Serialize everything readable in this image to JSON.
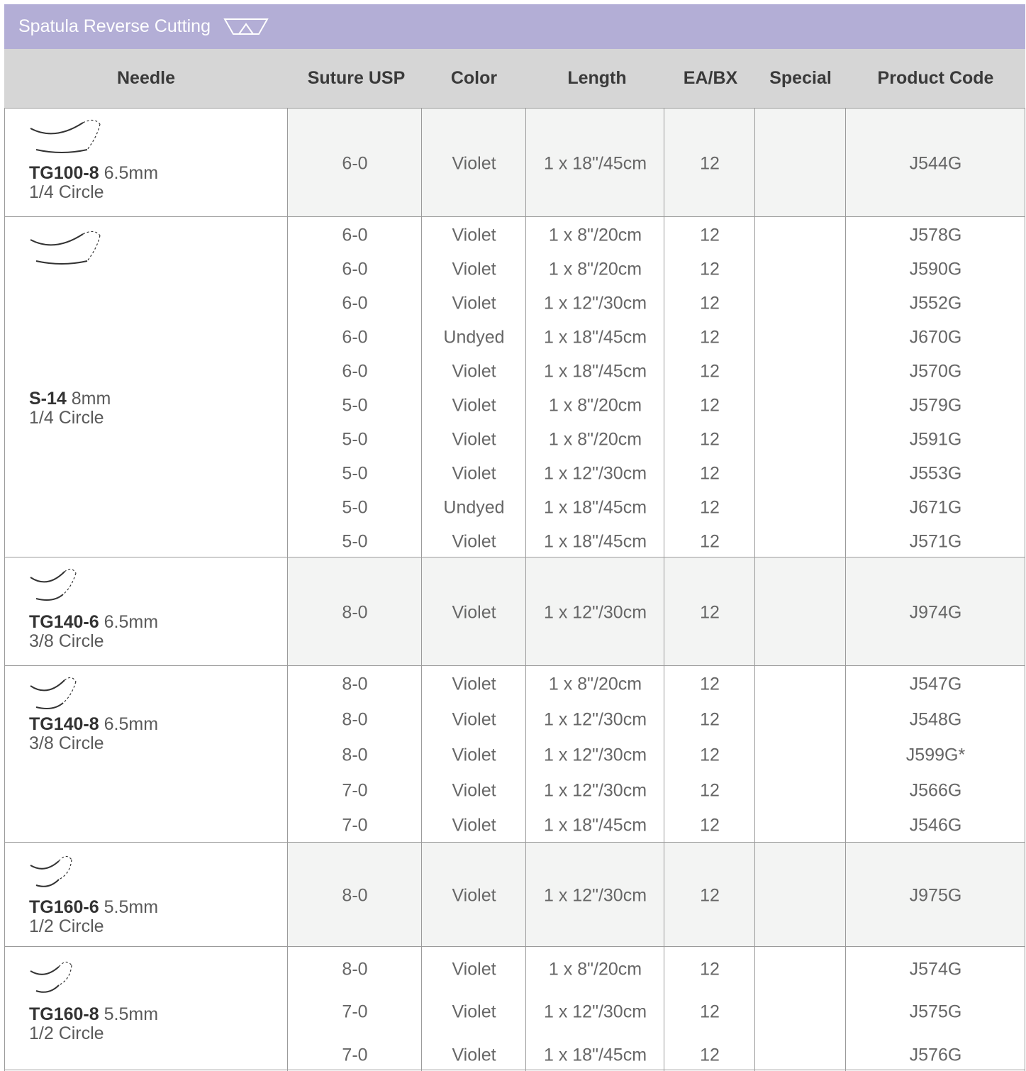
{
  "section": {
    "title": "Spatula Reverse Cutting",
    "icon": "spatula-reverse-cutting-cross-section-icon"
  },
  "columns": [
    "Needle",
    "Suture USP",
    "Color",
    "Length",
    "EA/BX",
    "Special",
    "Product Code"
  ],
  "groups": [
    {
      "needle": "TG100-8",
      "size": "6.5mm",
      "curvature": "1/4 Circle",
      "icon": "quarter-circle-needle-icon",
      "shaded": true,
      "rows": [
        {
          "usp": "6-0",
          "color": "Violet",
          "length": "1 x 18\"/45cm",
          "eabx": "12",
          "special": "",
          "code": "J544G"
        }
      ]
    },
    {
      "needle": "S-14",
      "size": "8mm",
      "curvature": "1/4 Circle",
      "icon": "quarter-circle-needle-icon",
      "shaded": false,
      "rows": [
        {
          "usp": "6-0",
          "color": "Violet",
          "length": "1 x 8\"/20cm",
          "eabx": "12",
          "special": "",
          "code": "J578G"
        },
        {
          "usp": "6-0",
          "color": "Violet",
          "length": "1 x 8\"/20cm",
          "eabx": "12",
          "special": "",
          "code": "J590G"
        },
        {
          "usp": "6-0",
          "color": "Violet",
          "length": "1 x 12\"/30cm",
          "eabx": "12",
          "special": "",
          "code": "J552G"
        },
        {
          "usp": "6-0",
          "color": "Undyed",
          "length": "1 x 18\"/45cm",
          "eabx": "12",
          "special": "",
          "code": "J670G"
        },
        {
          "usp": "6-0",
          "color": "Violet",
          "length": "1 x 18\"/45cm",
          "eabx": "12",
          "special": "",
          "code": "J570G"
        },
        {
          "usp": "5-0",
          "color": "Violet",
          "length": "1 x 8\"/20cm",
          "eabx": "12",
          "special": "",
          "code": "J579G"
        },
        {
          "usp": "5-0",
          "color": "Violet",
          "length": "1 x 8\"/20cm",
          "eabx": "12",
          "special": "",
          "code": "J591G"
        },
        {
          "usp": "5-0",
          "color": "Violet",
          "length": "1 x 12\"/30cm",
          "eabx": "12",
          "special": "",
          "code": "J553G"
        },
        {
          "usp": "5-0",
          "color": "Undyed",
          "length": "1 x 18\"/45cm",
          "eabx": "12",
          "special": "",
          "code": "J671G"
        },
        {
          "usp": "5-0",
          "color": "Violet",
          "length": "1 x 18\"/45cm",
          "eabx": "12",
          "special": "",
          "code": "J571G"
        }
      ]
    },
    {
      "needle": "TG140-6",
      "size": "6.5mm",
      "curvature": "3/8 Circle",
      "icon": "three-eighths-circle-needle-icon",
      "shaded": true,
      "rows": [
        {
          "usp": "8-0",
          "color": "Violet",
          "length": "1 x 12\"/30cm",
          "eabx": "12",
          "special": "",
          "code": "J974G"
        }
      ]
    },
    {
      "needle": "TG140-8",
      "size": "6.5mm",
      "curvature": "3/8 Circle",
      "icon": "three-eighths-circle-needle-icon",
      "shaded": false,
      "rows": [
        {
          "usp": "8-0",
          "color": "Violet",
          "length": "1 x 8\"/20cm",
          "eabx": "12",
          "special": "",
          "code": "J547G"
        },
        {
          "usp": "8-0",
          "color": "Violet",
          "length": "1 x 12\"/30cm",
          "eabx": "12",
          "special": "",
          "code": "J548G"
        },
        {
          "usp": "8-0",
          "color": "Violet",
          "length": "1 x 12\"/30cm",
          "eabx": "12",
          "special": "",
          "code": "J599G*"
        },
        {
          "usp": "7-0",
          "color": "Violet",
          "length": "1 x 12\"/30cm",
          "eabx": "12",
          "special": "",
          "code": "J566G"
        },
        {
          "usp": "7-0",
          "color": "Violet",
          "length": "1 x 18\"/45cm",
          "eabx": "12",
          "special": "",
          "code": "J546G"
        }
      ]
    },
    {
      "needle": "TG160-6",
      "size": "5.5mm",
      "curvature": "1/2 Circle",
      "icon": "half-circle-needle-icon",
      "shaded": true,
      "rows": [
        {
          "usp": "8-0",
          "color": "Violet",
          "length": "1 x 12\"/30cm",
          "eabx": "12",
          "special": "",
          "code": "J975G"
        }
      ]
    },
    {
      "needle": "TG160-8",
      "size": "5.5mm",
      "curvature": "1/2 Circle",
      "icon": "half-circle-needle-icon",
      "shaded": false,
      "rows": [
        {
          "usp": "8-0",
          "color": "Violet",
          "length": "1 x 8\"/20cm",
          "eabx": "12",
          "special": "",
          "code": "J574G"
        },
        {
          "usp": "7-0",
          "color": "Violet",
          "length": "1 x 12\"/30cm",
          "eabx": "12",
          "special": "",
          "code": "J575G"
        },
        {
          "usp": "7-0",
          "color": "Violet",
          "length": "1 x 18\"/45cm",
          "eabx": "12",
          "special": "",
          "code": "J576G"
        }
      ]
    }
  ],
  "colors": {
    "banner": "#b3aed6",
    "header": "#d6d6d6",
    "shaded_row": "#f3f4f3",
    "grid": "#9b9b9b"
  }
}
